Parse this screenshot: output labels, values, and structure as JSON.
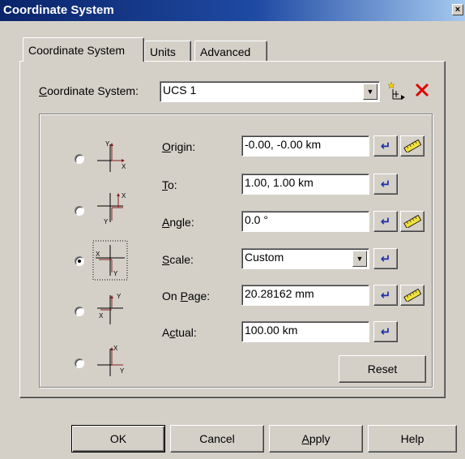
{
  "window": {
    "title": "Coordinate System",
    "close_glyph": "×"
  },
  "tabs": [
    {
      "label": "Coordinate System",
      "active": true
    },
    {
      "label": "Units",
      "active": false
    },
    {
      "label": "Advanced",
      "active": false
    }
  ],
  "coordinate_system": {
    "label_pre": "",
    "label_ul": "C",
    "label_post": "oordinate System:",
    "value": "UCS 1"
  },
  "fields": {
    "origin": {
      "label_ul": "O",
      "label_post": "rigin:",
      "label_pre": "",
      "value": "-0.00, -0.00 km"
    },
    "to": {
      "label_ul": "T",
      "label_post": "o:",
      "label_pre": "",
      "value": "1.00, 1.00 km"
    },
    "angle": {
      "label_ul": "A",
      "label_post": "ngle:",
      "label_pre": "",
      "value": "0.0 °"
    },
    "scale": {
      "label_ul": "S",
      "label_post": "cale:",
      "label_pre": "",
      "value": "Custom"
    },
    "on_page": {
      "label_pre": "On ",
      "label_ul": "P",
      "label_post": "age:",
      "value": "20.28162 mm"
    },
    "actual": {
      "label_pre": "A",
      "label_ul": "c",
      "label_post": "tual:",
      "value": "100.00 km"
    }
  },
  "axis_labels": {
    "x": "X",
    "y": "Y"
  },
  "buttons": {
    "reset": "Reset",
    "ok": "OK",
    "cancel": "Cancel",
    "apply_ul": "A",
    "apply_post": "pply",
    "help": "Help"
  },
  "selected_orientation": 3,
  "colors": {
    "axis": "#8b1a1a",
    "enter_arrow": "#1a2fa8",
    "delete_x": "#e00000",
    "ruler": "#f0e040"
  },
  "icons": {
    "new": "new-coordinate-system-icon",
    "delete": "delete-icon",
    "enter": "enter-arrow-icon",
    "measure": "ruler-icon"
  }
}
